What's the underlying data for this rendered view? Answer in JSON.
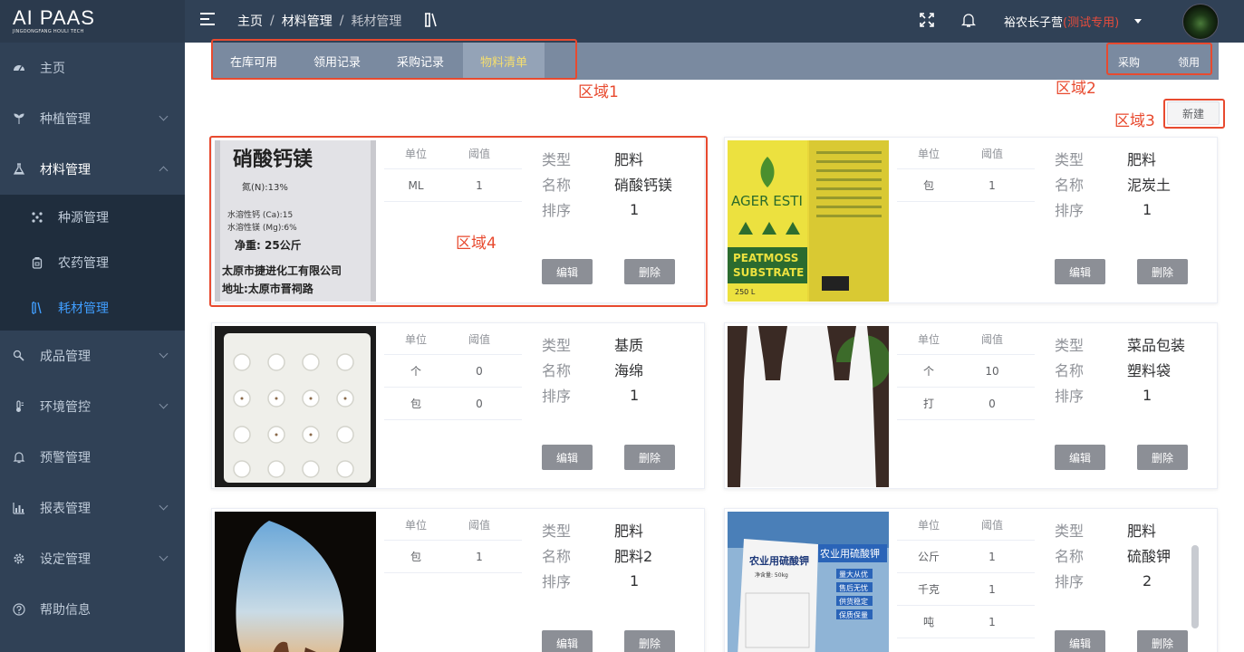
{
  "logo": {
    "main": "AI PAAS",
    "sub": "JINGDONGFANG HOULI TECH"
  },
  "sidebar": {
    "items": [
      {
        "label": "主页"
      },
      {
        "label": "种植管理"
      },
      {
        "label": "材料管理"
      },
      {
        "label": "成品管理"
      },
      {
        "label": "环境管控"
      },
      {
        "label": "预警管理"
      },
      {
        "label": "报表管理"
      },
      {
        "label": "设定管理"
      },
      {
        "label": "帮助信息"
      }
    ],
    "submenu": [
      {
        "label": "种源管理"
      },
      {
        "label": "农药管理"
      },
      {
        "label": "耗材管理"
      }
    ]
  },
  "header": {
    "breadcrumb": [
      "主页",
      "材料管理",
      "耗材管理"
    ],
    "separator": "/",
    "user": "裕农长子营",
    "user_tag": "(测试专用)"
  },
  "tabs": [
    {
      "label": "在库可用"
    },
    {
      "label": "领用记录"
    },
    {
      "label": "采购记录"
    },
    {
      "label": "物料清单"
    }
  ],
  "actions": {
    "purchase": "采购",
    "receive": "领用",
    "new": "新建"
  },
  "regions": [
    "区域1",
    "区域2",
    "区域3",
    "区域4"
  ],
  "spec_headers": {
    "unit": "单位",
    "threshold": "阈值"
  },
  "info_labels": {
    "type": "类型",
    "name": "名称",
    "order": "排序"
  },
  "buttons": {
    "edit": "编辑",
    "delete": "删除"
  },
  "cards": [
    {
      "type": "肥料",
      "name": "硝酸钙镁",
      "order": "1",
      "specs": [
        {
          "unit": "ML",
          "threshold": "1"
        }
      ],
      "image": {
        "text1": "硝酸钙镁",
        "text2": "氮(N):13%",
        "text3": "水溶性钙 (Ca):15",
        "text4": "水溶性镁 (Mg):6%",
        "text5": "净重: 25公斤",
        "text6": "太原市捷进化工有限公司",
        "text7": "地址:太原市晋祠路"
      }
    },
    {
      "type": "肥料",
      "name": "泥炭土",
      "order": "1",
      "specs": [
        {
          "unit": "包",
          "threshold": "1"
        }
      ],
      "image": {
        "text1": "AGER ESTI",
        "text2": "PEATMOSS",
        "text3": "SUBSTRATE",
        "text4": "250 L"
      }
    },
    {
      "type": "基质",
      "name": "海绵",
      "order": "1",
      "specs": [
        {
          "unit": "个",
          "threshold": "0"
        },
        {
          "unit": "包",
          "threshold": "0"
        }
      ]
    },
    {
      "type": "菜品包装",
      "name": "塑料袋",
      "order": "1",
      "specs": [
        {
          "unit": "个",
          "threshold": "10"
        },
        {
          "unit": "打",
          "threshold": "0"
        }
      ]
    },
    {
      "type": "肥料",
      "name": "肥料2",
      "order": "1",
      "specs": [
        {
          "unit": "包",
          "threshold": "1"
        }
      ]
    },
    {
      "type": "肥料",
      "name": "硫酸钾",
      "order": "2",
      "specs": [
        {
          "unit": "公斤",
          "threshold": "1"
        },
        {
          "unit": "千克",
          "threshold": "1"
        },
        {
          "unit": "吨",
          "threshold": "1"
        }
      ],
      "image": {
        "text1": "农业用硫酸钾",
        "text2": "农业用硫酸钾",
        "text3": "量大从优",
        "text4": "售后无忧",
        "text5": "供货稳定",
        "text6": "保质保量",
        "text7": "净含量: 50kg"
      }
    }
  ],
  "colors": {
    "sidebar": "#304156",
    "accent": "#409eff",
    "region": "#e84a2f",
    "tab_active": "#f5de6e"
  }
}
